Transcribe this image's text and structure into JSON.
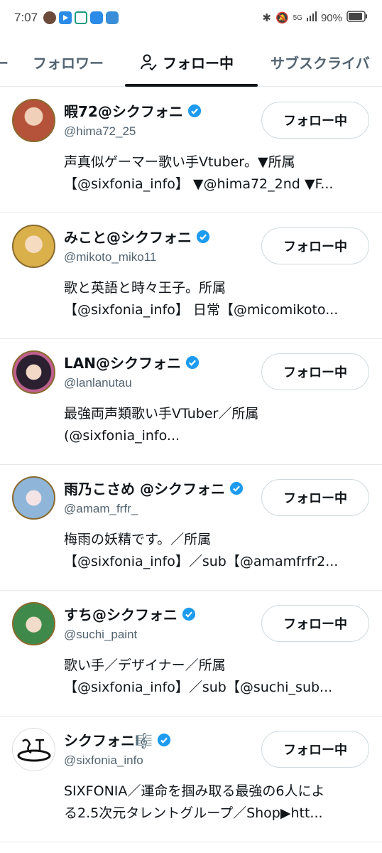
{
  "status_bar": {
    "time": "7:07",
    "battery": "90%",
    "network": "5G"
  },
  "tabs": [
    {
      "label": "ー"
    },
    {
      "label": "フォロワー"
    },
    {
      "label": "フォロー中"
    },
    {
      "label": "サブスクライバ"
    }
  ],
  "follow_label": "フォロー中",
  "accounts": [
    {
      "name": "暇72@シクフォニ",
      "handle": "@hima72_25",
      "bio1": "声真似ゲーマー歌い手Vtuber。▼所属",
      "bio2": "【@sixfonia_info】 ▼@hima72_2nd ▼F...",
      "avatar_color": "#b5533a"
    },
    {
      "name": "みこと@シクフォニ",
      "handle": "@mikoto_miko11",
      "bio1": "歌と英語と時々王子。所属",
      "bio2": "【@sixfonia_info】 日常【@micomikoto...",
      "avatar_color": "#d9b04a"
    },
    {
      "name": "LAN@シクフォニ",
      "handle": "@lanlanutau",
      "bio1": "最強両声類歌い手VTuber／所属",
      "bio2": "(@sixfonia_info...",
      "avatar_color": "#c0608f"
    },
    {
      "name": "雨乃こさめ @シクフォニ",
      "handle": "@amam_frfr_",
      "bio1": "梅雨の妖精です。／所属",
      "bio2": "【@sixfonia_info】／sub【@amamfrfr2...",
      "avatar_color": "#8fb6d8"
    },
    {
      "name": "すち@シクフォニ",
      "handle": "@suchi_paint",
      "bio1": "歌い手／デザイナー／所属",
      "bio2": "【@sixfonia_info】／sub【@suchi_sub...",
      "avatar_color": "#3f8a4a"
    },
    {
      "name": "シクフォニ🎼",
      "handle": "@sixfonia_info",
      "bio1": "SIXFONIA／運命を掴み取る最強の6人によ",
      "bio2": "る2.5次元タレントグループ／Shop▶htt...",
      "avatar_color": "#ffffff"
    }
  ]
}
